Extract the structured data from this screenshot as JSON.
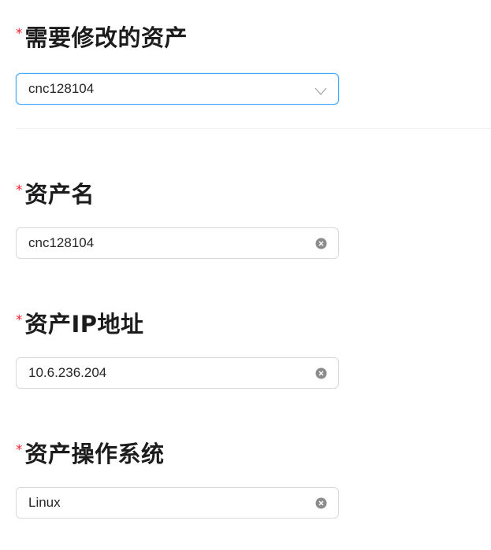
{
  "form": {
    "asset_select": {
      "required_mark": "*",
      "label": "需要修改的资产",
      "value": "cnc128104",
      "icon": "chevron-down-icon"
    },
    "asset_name": {
      "required_mark": "*",
      "label": "资产名",
      "value": "cnc128104",
      "icon": "clear-icon"
    },
    "asset_ip": {
      "required_mark": "*",
      "label": "资产IP地址",
      "value": "10.6.236.204",
      "icon": "clear-icon"
    },
    "asset_os": {
      "required_mark": "*",
      "label": "资产操作系统",
      "value": "Linux",
      "icon": "clear-icon"
    }
  },
  "colors": {
    "required": "#f5222d",
    "focus_border": "#40a9ff",
    "border": "#d9d9d9",
    "clear_icon": "#8c8c8c"
  }
}
